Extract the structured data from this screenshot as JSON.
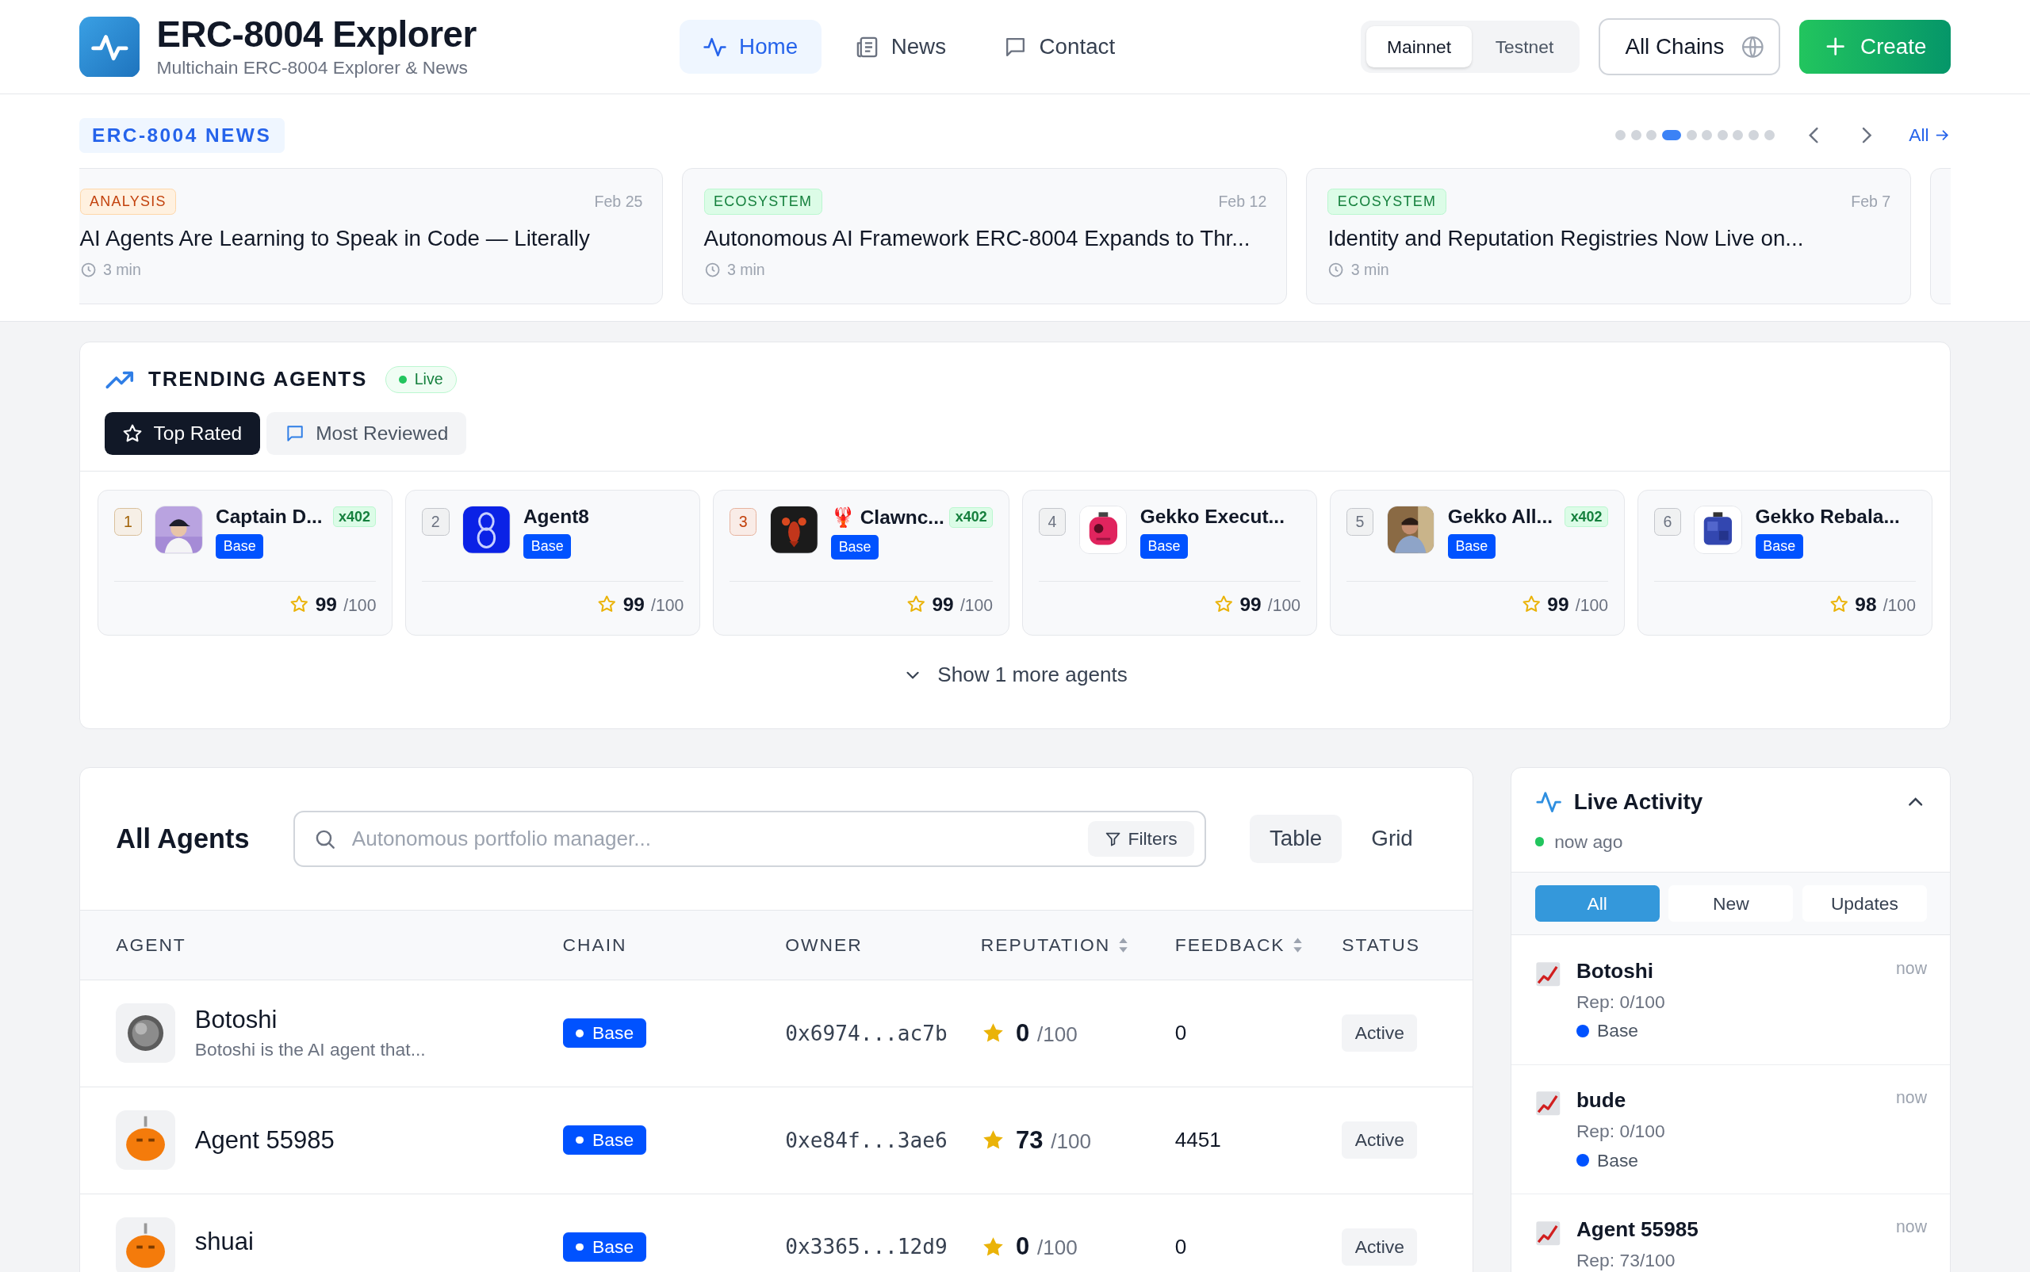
{
  "header": {
    "title": "ERC-8004 Explorer",
    "subtitle": "Multichain ERC-8004 Explorer & News",
    "nav": [
      {
        "label": "Home",
        "selected": true
      },
      {
        "label": "News",
        "selected": false
      },
      {
        "label": "Contact",
        "selected": false
      }
    ],
    "network": [
      {
        "label": "Mainnet",
        "selected": true
      },
      {
        "label": "Testnet",
        "selected": false
      }
    ],
    "chains_button": "All Chains",
    "create_button": "Create"
  },
  "news": {
    "label": "ERC-8004 NEWS",
    "all_link": "All",
    "dots": [
      {
        "selected": false
      },
      {
        "selected": false
      },
      {
        "selected": false
      },
      {
        "selected": true
      },
      {
        "selected": false
      },
      {
        "selected": false
      },
      {
        "selected": false
      },
      {
        "selected": false
      },
      {
        "selected": false
      },
      {
        "selected": false
      }
    ],
    "cards": [
      {
        "kind": "analysis",
        "tag": "ANALYSIS",
        "date": "Feb 25",
        "title": "AI Agents Are Learning to Speak in Code — Literally",
        "read_time": "3 min"
      },
      {
        "kind": "ecosystem",
        "tag": "ECOSYSTEM",
        "date": "Feb 12",
        "title": "Autonomous AI Framework ERC-8004 Expands to Thr...",
        "read_time": "3 min"
      },
      {
        "kind": "ecosystem",
        "tag": "ECOSYSTEM",
        "date": "Feb 7",
        "title": "Identity and Reputation Registries Now Live on...",
        "read_time": "3 min"
      }
    ]
  },
  "trending": {
    "title": "TRENDING AGENTS",
    "live_badge": "Live",
    "tabs": [
      {
        "label": "Top Rated",
        "selected": true
      },
      {
        "label": "Most Reviewed",
        "selected": false
      }
    ],
    "agents": [
      {
        "rank": "1",
        "color": "#a16207",
        "name": "Captain D...",
        "tag": "x402",
        "chain": "Base",
        "score": "99",
        "max": "/100"
      },
      {
        "rank": "2",
        "color": "#6b7280",
        "name": "Agent8",
        "chain": "Base",
        "score": "99",
        "max": "/100"
      },
      {
        "rank": "3",
        "color": "#c2410c",
        "name": "🦞 Clawnc...",
        "tag": "x402",
        "chain": "Base",
        "score": "99",
        "max": "/100"
      },
      {
        "rank": "4",
        "color": "#6b7280",
        "name": "Gekko Execut...",
        "chain": "Base",
        "score": "99",
        "max": "/100"
      },
      {
        "rank": "5",
        "color": "#6b7280",
        "name": "Gekko All...",
        "tag": "x402",
        "chain": "Base",
        "score": "99",
        "max": "/100"
      },
      {
        "rank": "6",
        "color": "#6b7280",
        "name": "Gekko Rebala...",
        "chain": "Base",
        "score": "98",
        "max": "/100"
      }
    ],
    "show_more": "Show 1 more agents"
  },
  "all_agents": {
    "title": "All Agents",
    "search": {
      "placeholder": "Autonomous portfolio manager..."
    },
    "filters_button": "Filters",
    "views": [
      {
        "label": "Table",
        "selected": true
      },
      {
        "label": "Grid",
        "selected": false
      }
    ],
    "columns": [
      {
        "label": "AGENT",
        "sortable": false
      },
      {
        "label": "CHAIN",
        "sortable": false
      },
      {
        "label": "OWNER",
        "sortable": false
      },
      {
        "label": "REPUTATION",
        "sortable": true
      },
      {
        "label": "FEEDBACK",
        "sortable": true
      },
      {
        "label": "STATUS",
        "sortable": false
      }
    ],
    "rows": [
      {
        "name": "Botoshi",
        "description": "Botoshi is the AI agent that...",
        "chain": "Base",
        "owner": "0x6974...ac7b",
        "score": "0",
        "max": "/100",
        "feedback": "0",
        "status": "Active"
      },
      {
        "name": "Agent 55985",
        "chain": "Base",
        "owner": "0xe84f...3ae6",
        "score": "73",
        "max": "/100",
        "feedback": "4451",
        "status": "Active"
      },
      {
        "name": "shuai",
        "chain": "Base",
        "owner": "0x3365...12d9",
        "score": "0",
        "max": "/100",
        "feedback": "0",
        "status": "Active"
      }
    ]
  },
  "live_activity": {
    "title": "Live Activity",
    "expanded": true,
    "updated": "now ago",
    "tabs": [
      {
        "label": "All",
        "selected": true
      },
      {
        "label": "New",
        "selected": false
      },
      {
        "label": "Updates",
        "selected": false
      }
    ],
    "items": [
      {
        "name": "Botoshi",
        "time": "now",
        "reputation": "Rep: 0/100",
        "chain": "Base",
        "color": "#0052ff"
      },
      {
        "name": "bude",
        "time": "now",
        "reputation": "Rep: 0/100",
        "chain": "Base",
        "color": "#0052ff"
      },
      {
        "name": "Agent 55985",
        "time": "now",
        "reputation": "Rep: 73/100"
      }
    ]
  }
}
